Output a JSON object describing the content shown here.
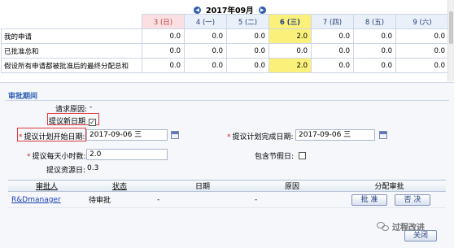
{
  "timesheet": {
    "month": "2017年09月",
    "prev_icon": "arrow-left-icon",
    "next_icon": "arrow-right-icon",
    "days": [
      {
        "label": "3 (日)",
        "style": "weekend"
      },
      {
        "label": "4 (一)",
        "style": "normal"
      },
      {
        "label": "5 (二)",
        "style": "normal"
      },
      {
        "label": "6 (三)",
        "style": "today"
      },
      {
        "label": "7 (四)",
        "style": "normal"
      },
      {
        "label": "8 (五)",
        "style": "normal"
      },
      {
        "label": "9 (六)",
        "style": "normal"
      }
    ],
    "rows": [
      {
        "label": "我的申请",
        "values": [
          "0.0",
          "0.0",
          "0.0",
          "2.0",
          "0.0",
          "0.0",
          "0.0"
        ]
      },
      {
        "label": "已批准总和",
        "values": [
          "0.0",
          "0.0",
          "0.0",
          "0.0",
          "0.0",
          "0.0",
          "0.0"
        ]
      },
      {
        "label": "假设所有申请都被批准后的最终分配总和",
        "values": [
          "0.0",
          "0.0",
          "0.0",
          "2.0",
          "0.0",
          "0.0",
          "0.0"
        ]
      }
    ],
    "highlight_index": 3,
    "colors": {
      "weekend": "#fbe0e3",
      "today": "#fbf17a",
      "header": "#eaf0fa"
    }
  },
  "form": {
    "section_title": "审批期间",
    "request_reason_label": "请求原因:",
    "request_reason_value": "-",
    "propose_new_date_label": "提议新日期",
    "propose_new_date_checked": true,
    "start_date_label": "提议计划开始日期:",
    "start_date_value": "2017-09-06 三",
    "end_date_label": "提议计划完成日期:",
    "end_date_value": "2017-09-06 三",
    "hours_label": "提议每天小时数:",
    "hours_value": "2.0",
    "holiday_label": "包含节假日:",
    "holiday_checked": false,
    "resource_label": "提议资源日:",
    "resource_value": "0.3",
    "required_mark": "*"
  },
  "approvers": {
    "headers": {
      "approver": "审批人",
      "status": "状态",
      "date": "日期",
      "reason": "原因",
      "assign": "分配审批"
    },
    "rows": [
      {
        "approver": "R&Dmanager",
        "status": "待审批",
        "date": "-",
        "reason": "-",
        "approve": "批 准",
        "reject": "否 决"
      }
    ]
  },
  "close_label": "关闭",
  "watermark": "过程改进"
}
